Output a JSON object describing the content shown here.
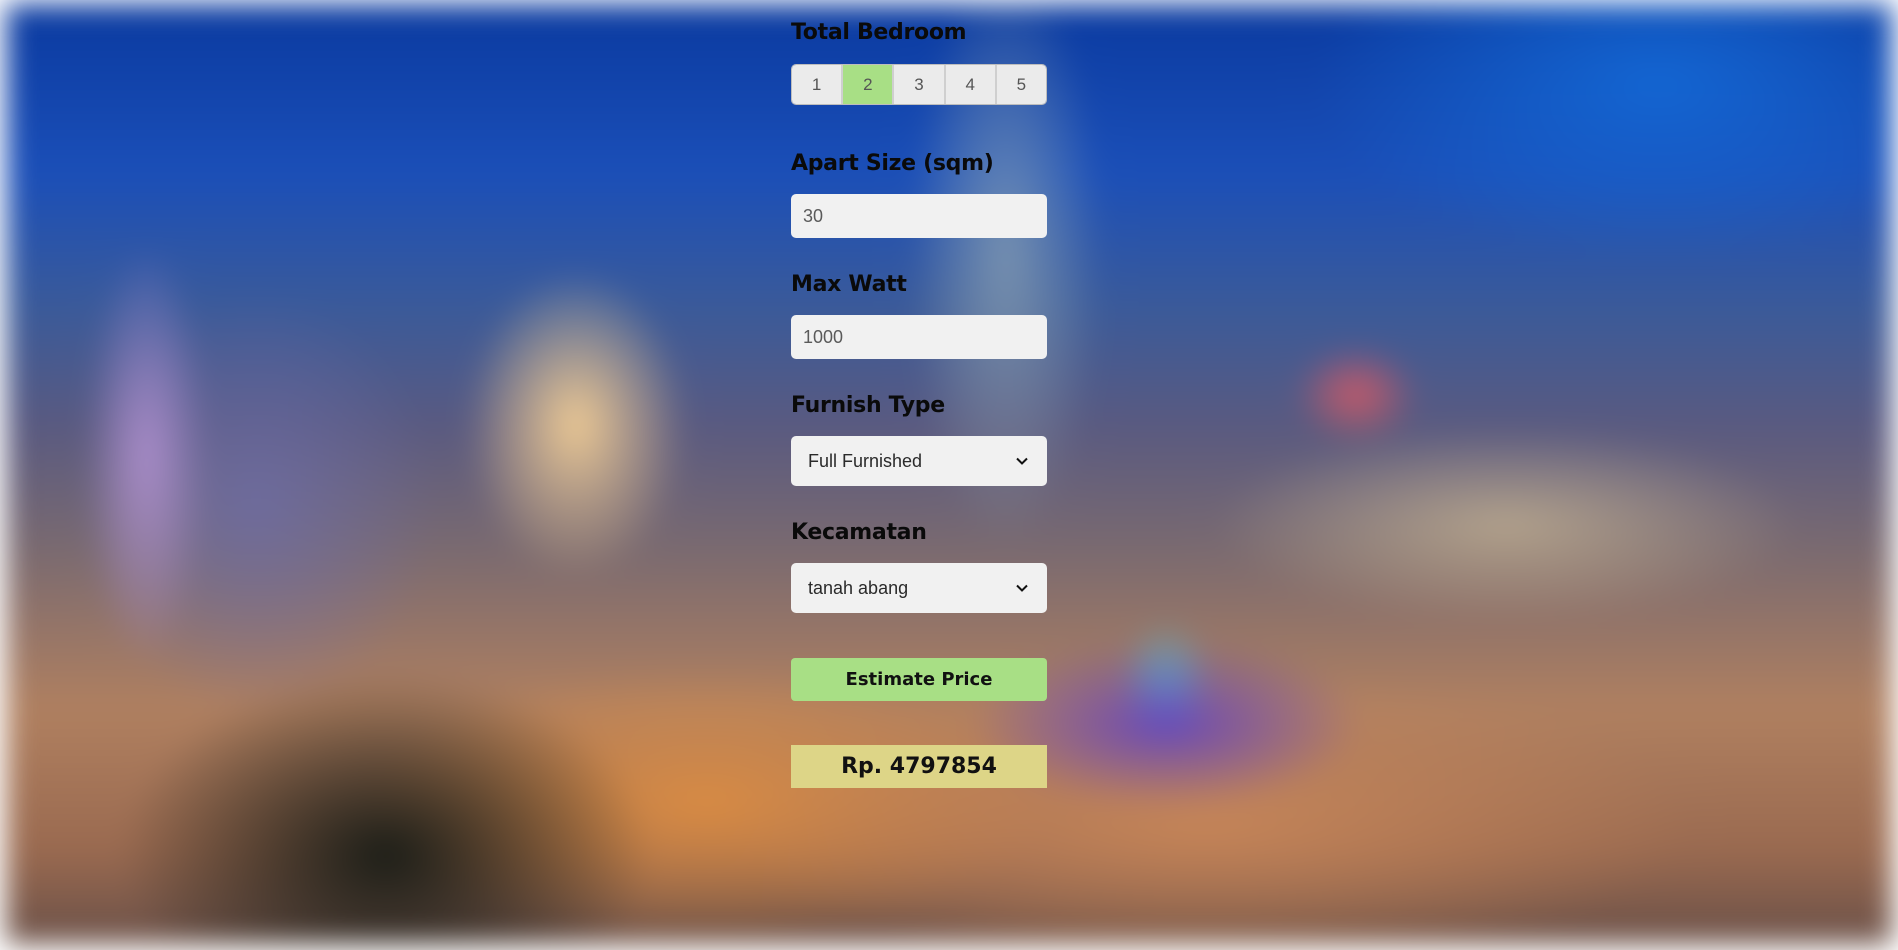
{
  "background": {
    "description_icon": "city-night-photo"
  },
  "form": {
    "bedroom": {
      "label": "Total Bedroom",
      "options": [
        "1",
        "2",
        "3",
        "4",
        "5"
      ],
      "selected": "2",
      "active_color": "#a8df85"
    },
    "size": {
      "label": "Apart Size (sqm)",
      "value": "30"
    },
    "watt": {
      "label": "Max Watt",
      "value": "1000"
    },
    "furnish": {
      "label": "Furnish Type",
      "selected": "Full Furnished"
    },
    "kecamatan": {
      "label": "Kecamatan",
      "selected": "tanah abang"
    },
    "submit_label": "Estimate Price",
    "submit_color": "#a8df85",
    "result": {
      "text": "Rp. 4797854",
      "color": "#ddd587"
    }
  }
}
